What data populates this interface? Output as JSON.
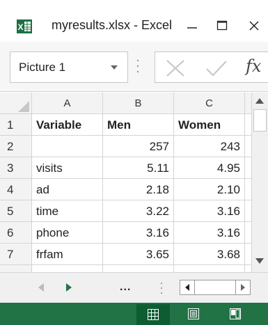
{
  "window": {
    "title": "myresults.xlsx - Excel",
    "app_icon": "excel-icon",
    "controls": [
      "minimize-icon",
      "maximize-icon",
      "close-icon"
    ]
  },
  "formula_bar": {
    "name_box": "Picture 1",
    "fx_label": "fx",
    "formula_value": ""
  },
  "sheet": {
    "column_headers": [
      "A",
      "B",
      "C"
    ],
    "rows": [
      {
        "num": "1",
        "a": "Variable",
        "b": "Men",
        "c": "Women"
      },
      {
        "num": "2",
        "a": "",
        "b": "257",
        "c": "243"
      },
      {
        "num": "3",
        "a": "visits",
        "b": "5.11",
        "c": "4.95"
      },
      {
        "num": "4",
        "a": "ad",
        "b": "2.18",
        "c": "2.10"
      },
      {
        "num": "5",
        "a": "time",
        "b": "3.22",
        "c": "3.16"
      },
      {
        "num": "6",
        "a": "phone",
        "b": "3.16",
        "c": "3.16"
      },
      {
        "num": "7",
        "a": "frfam",
        "b": "3.65",
        "c": "3.68"
      }
    ]
  },
  "tabbar": {
    "more_label": "..."
  },
  "statusbar": {
    "views": [
      "normal-view-icon",
      "page-layout-icon",
      "page-break-preview-icon"
    ]
  },
  "colors": {
    "status_green": "#217346",
    "active_view": "#0e5c32",
    "excel_green": "#1d6f42"
  }
}
